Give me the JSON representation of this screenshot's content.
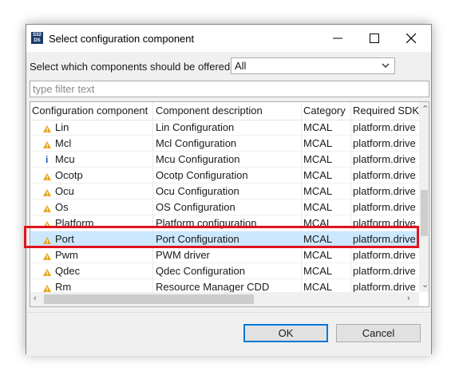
{
  "dialog": {
    "title": "Select configuration component",
    "app_icon_text": "S32 DS"
  },
  "offer": {
    "label": "Select which components should be offered",
    "selected": "All"
  },
  "filter": {
    "placeholder": "type filter text",
    "value": ""
  },
  "table": {
    "columns": [
      "Configuration component",
      "Component description",
      "Category",
      "Required SDK"
    ],
    "rows": [
      {
        "name": "Lin",
        "description": "Lin Configuration",
        "category": "MCAL",
        "sdk": "platform.drive",
        "icon": "warning-icon"
      },
      {
        "name": "Mcl",
        "description": "Mcl Configuration",
        "category": "MCAL",
        "sdk": "platform.drive",
        "icon": "warning-icon"
      },
      {
        "name": "Mcu",
        "description": "Mcu Configuration",
        "category": "MCAL",
        "sdk": "platform.drive",
        "icon": "info-icon"
      },
      {
        "name": "Ocotp",
        "description": "Ocotp Configuration",
        "category": "MCAL",
        "sdk": "platform.drive",
        "icon": "warning-icon"
      },
      {
        "name": "Ocu",
        "description": "Ocu Configuration",
        "category": "MCAL",
        "sdk": "platform.drive",
        "icon": "warning-icon"
      },
      {
        "name": "Os",
        "description": "OS Configuration",
        "category": "MCAL",
        "sdk": "platform.drive",
        "icon": "warning-icon"
      },
      {
        "name": "Platform",
        "description": "Platform configuration",
        "category": "MCAL",
        "sdk": "platform.drive",
        "icon": "warning-icon"
      },
      {
        "name": "Port",
        "description": "Port Configuration",
        "category": "MCAL",
        "sdk": "platform.drive",
        "icon": "warning-icon",
        "selected": true
      },
      {
        "name": "Pwm",
        "description": "PWM driver",
        "category": "MCAL",
        "sdk": "platform.drive",
        "icon": "warning-icon"
      },
      {
        "name": "Qdec",
        "description": "Qdec Configuration",
        "category": "MCAL",
        "sdk": "platform.drive",
        "icon": "warning-icon"
      },
      {
        "name": "Rm",
        "description": "Resource Manager CDD",
        "category": "MCAL",
        "sdk": "platform.drive",
        "icon": "warning-icon"
      }
    ]
  },
  "buttons": {
    "ok": "OK",
    "cancel": "Cancel"
  },
  "colors": {
    "selection": "#cce8ff",
    "highlight_box": "#e0141e",
    "warning_icon": "#e8a317",
    "info_icon": "#1f4fb8",
    "default_button_border": "#0078d7"
  }
}
